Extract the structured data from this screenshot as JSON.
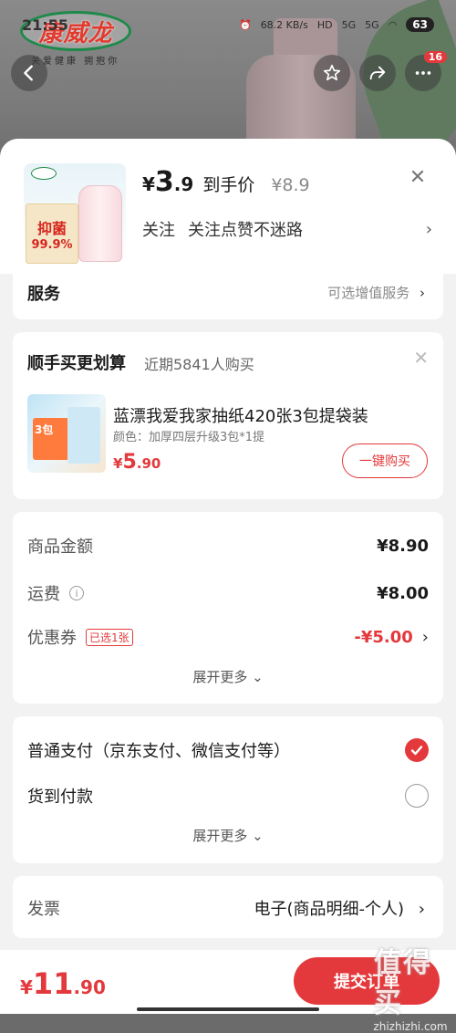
{
  "status_bar": {
    "time": "21:55",
    "net_speed": "68.2 KB/s",
    "hd": "HD",
    "signal_1": "5G",
    "signal_2": "5G",
    "battery": "63"
  },
  "background": {
    "brand_logo": "康威龙",
    "brand_slogan": "关爱健康 拥抱你",
    "cart_badge": "16"
  },
  "product": {
    "currency": "¥",
    "price_int": "3",
    "price_dec": ".9",
    "price_tag": "到手价",
    "original_price": "¥8.9",
    "follow_label": "关注",
    "follow_text": "关注点赞不迷路",
    "thumb_promo_1": "抑菌",
    "thumb_promo_2": "99.9%"
  },
  "service": {
    "title": "服务",
    "right_text": "可选增值服务"
  },
  "bundle": {
    "title": "顺手买更划算",
    "subtitle": "近期5841人购买",
    "item_name": "蓝漂我爱我家抽纸420张3包提袋装",
    "item_spec": "颜色：加厚四层升级3包*1提",
    "price_currency": "¥",
    "price_int": "5",
    "price_dec": ".90",
    "buy_label": "一键购买",
    "img_label": "3包"
  },
  "amounts": {
    "goods_label": "商品金额",
    "goods_value": "¥8.90",
    "shipping_label": "运费",
    "shipping_value": "¥8.00",
    "coupon_label": "优惠券",
    "coupon_tag": "已选1张",
    "coupon_value": "-¥5.00",
    "expand_label": "展开更多"
  },
  "payment": {
    "option_1": "普通支付（京东支付、微信支付等）",
    "option_1_selected": true,
    "option_2": "货到付款",
    "option_2_selected": false,
    "expand_label": "展开更多"
  },
  "invoice": {
    "label": "发票",
    "value": "电子(商品明细-个人)"
  },
  "bottom_bar": {
    "total_currency": "¥",
    "total_int": "11",
    "total_dec": ".90",
    "submit_label": "提交订单"
  },
  "watermark": {
    "big": "值得买",
    "small": "zhizhizhi.com"
  },
  "colors": {
    "accent": "#e4393c",
    "page_bg": "#f2f2f2"
  }
}
